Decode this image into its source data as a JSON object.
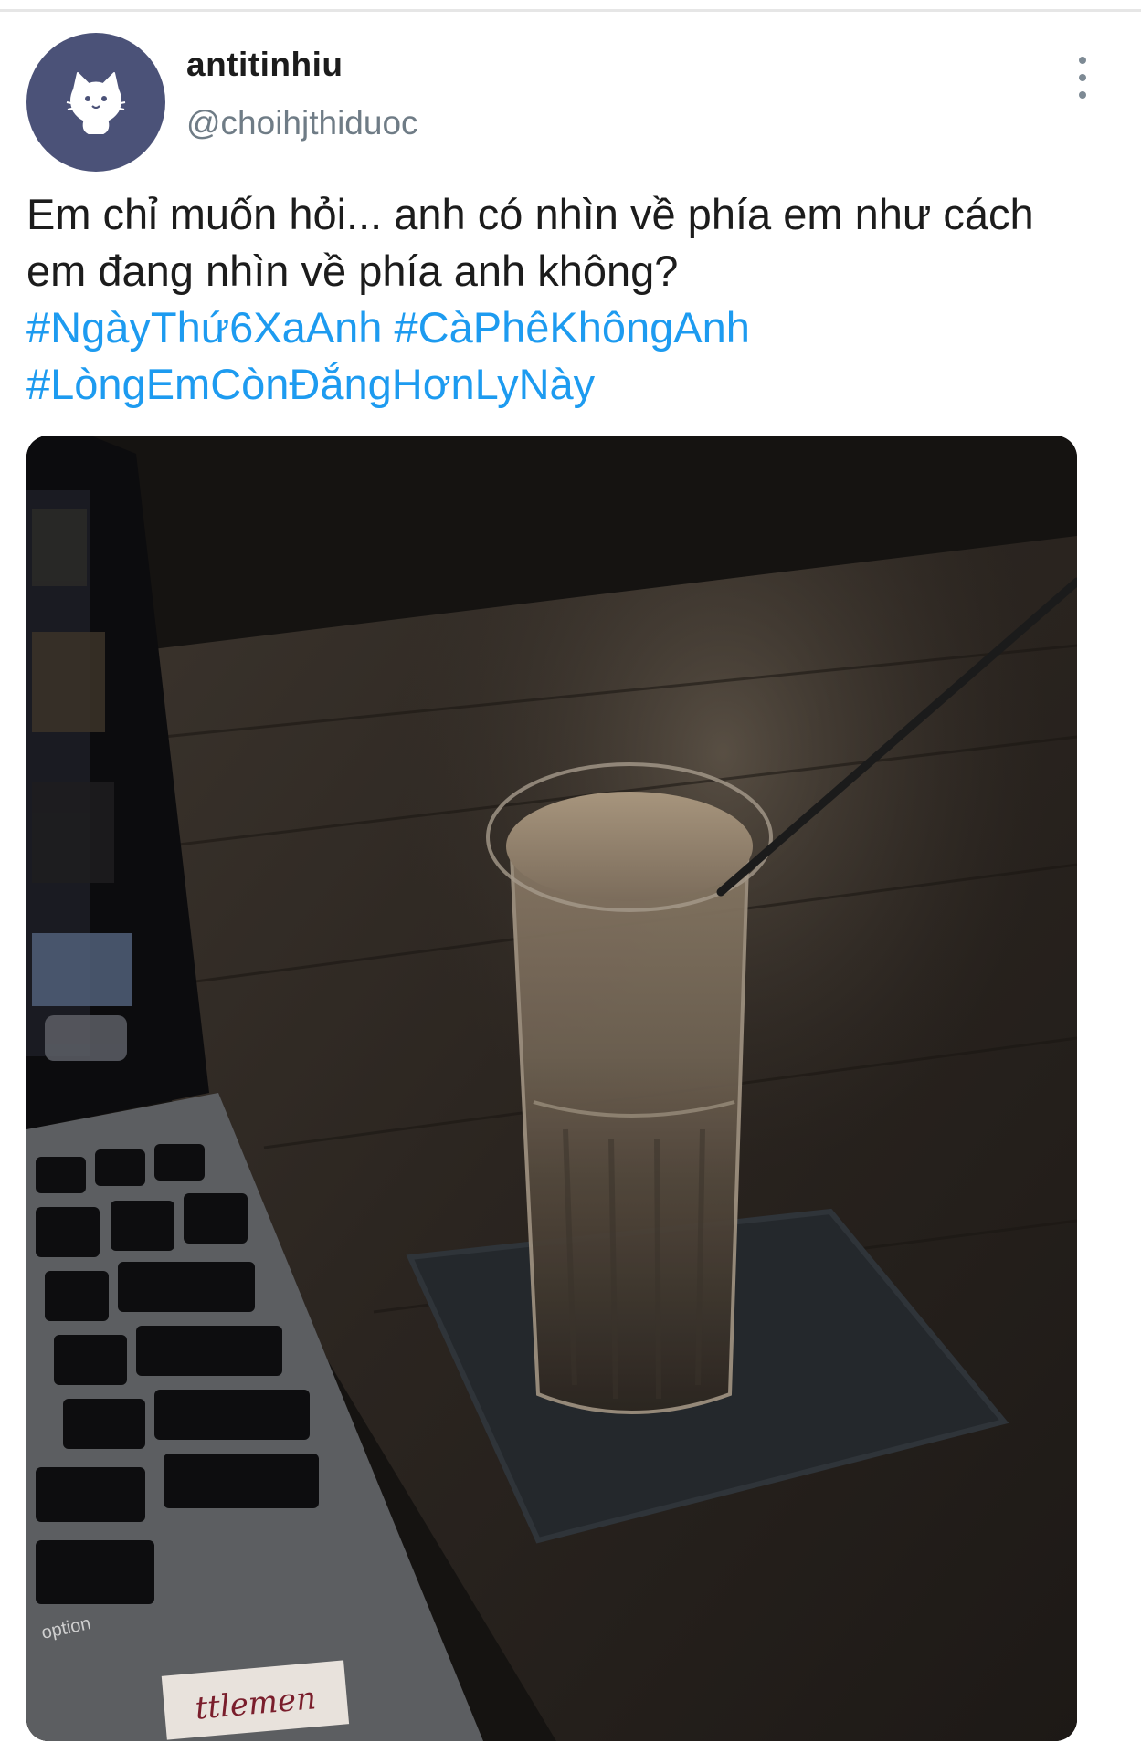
{
  "tweet": {
    "author": {
      "display_name": "antitinhiu",
      "handle": "@choihjthiduoc",
      "avatar_icon": "cat-avatar-icon"
    },
    "menu_icon": "more-vertical-icon",
    "text_line1": "Em chỉ muốn hỏi... anh có nhìn về phía em như cách",
    "text_line2": "em đang nhìn về phía anh không?",
    "hashtags": [
      "#NgàyThứ6XaAnh",
      "#CàPhêKhôngAnh",
      "#LòngEmCònĐắngHơnLyNày"
    ],
    "media": {
      "icon": "photo-coffee-laptop",
      "sticker_text": "ttlemen",
      "key_label": "option"
    }
  },
  "colors": {
    "text": "#1c1c1c",
    "secondary": "#6f7c86",
    "link": "#1d9bf0",
    "avatar_bg": "#4b5278"
  }
}
